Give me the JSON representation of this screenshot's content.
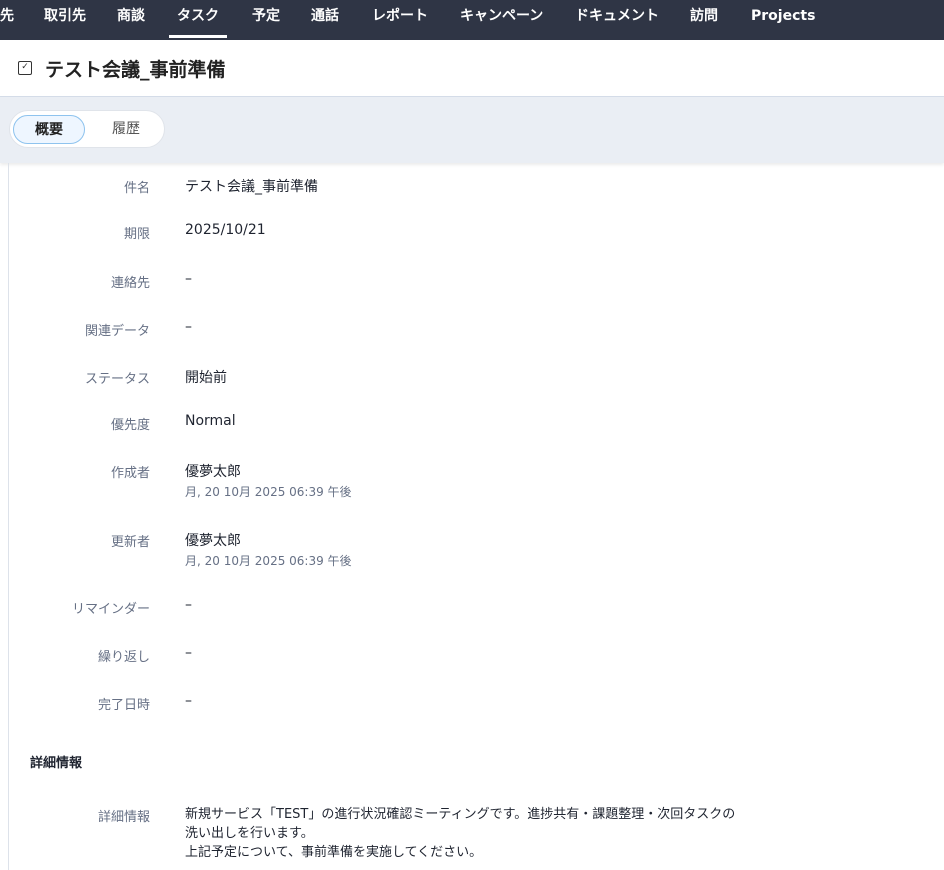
{
  "nav": {
    "items": [
      "先",
      "取引先",
      "商談",
      "タスク",
      "予定",
      "通話",
      "レポート",
      "キャンペーン",
      "ドキュメント",
      "訪問",
      "Projects"
    ],
    "active": "タスク"
  },
  "header": {
    "title": "テスト会議_事前準備",
    "icon": "task-check-icon"
  },
  "tabs": {
    "overview": "概要",
    "history": "履歴"
  },
  "fields": [
    {
      "label": "件名",
      "value": "テスト会議_事前準備"
    },
    {
      "label": "期限",
      "value": "2025/10/21"
    },
    {
      "label": "連絡先",
      "value": "–"
    },
    {
      "label": "関連データ",
      "value": "–"
    },
    {
      "label": "ステータス",
      "value": "開始前"
    },
    {
      "label": "優先度",
      "value": "Normal"
    },
    {
      "label": "作成者",
      "value": "優夢太郎",
      "sub": "月, 20 10月 2025 06:39 午後"
    },
    {
      "label": "更新者",
      "value": "優夢太郎",
      "sub": "月, 20 10月 2025 06:39 午後"
    },
    {
      "label": "リマインダー",
      "value": "–"
    },
    {
      "label": "繰り返し",
      "value": "–"
    },
    {
      "label": "完了日時",
      "value": "–"
    }
  ],
  "details_section": {
    "title": "詳細情報",
    "label": "詳細情報",
    "lines": [
      "新規サービス「TEST」の進行状況確認ミーティングです。進捗共有・課題整理・次回タスクの",
      "洗い出しを行います。",
      "上記予定について、事前準備を実施してください。"
    ]
  }
}
